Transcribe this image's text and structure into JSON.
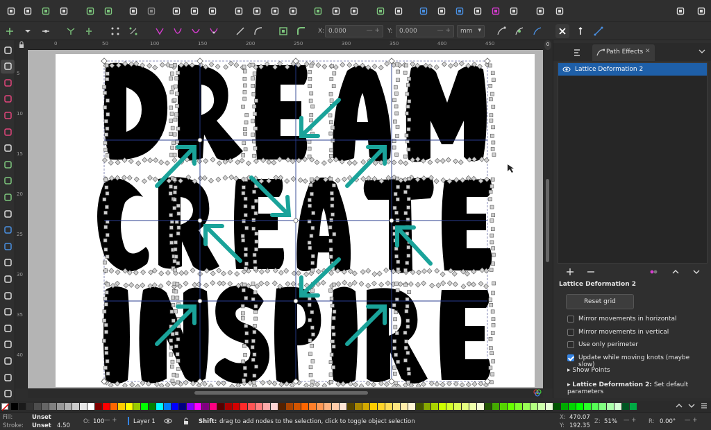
{
  "command_bar": {
    "icons": [
      "new-document-icon",
      "open-icon",
      "save-icon",
      "print-icon",
      "import-icon",
      "export-icon",
      "undo-icon",
      "redo-icon",
      "copy-icon",
      "cut-icon",
      "paste-icon",
      "zoom-selection-icon",
      "zoom-drawing-icon",
      "zoom-page-icon",
      "zoom-fit-icon",
      "group-icon",
      "ungroup-icon",
      "duplicate-icon",
      "clone-icon",
      "unlink-clone-icon",
      "fill-stroke-icon",
      "text-font-icon",
      "layers-icon",
      "xml-editor-icon",
      "align-distribute-icon",
      "object-properties-icon",
      "find-replace-icon",
      "preferences-icon",
      "snap-toggle-icon",
      "commands-more-icon"
    ]
  },
  "tool_controls": {
    "x_label": "X:",
    "x_value": "0.000",
    "y_label": "Y:",
    "y_value": "0.000",
    "unit": "mm"
  },
  "toolbox": {
    "tools": [
      "selector-tool-icon",
      "node-tool-icon",
      "rectangle-tool-icon",
      "ellipse-tool-icon",
      "star-tool-icon",
      "3dbox-tool-icon",
      "spiral-tool-icon",
      "pencil-tool-icon",
      "pen-tool-icon",
      "calligraphy-tool-icon",
      "text-tool-icon",
      "gradient-tool-icon",
      "mesh-tool-icon",
      "dropper-tool-icon",
      "paint-bucket-tool-icon",
      "tweak-tool-icon",
      "spray-tool-icon",
      "eraser-tool-icon",
      "connector-tool-icon",
      "measure-tool-icon",
      "zoom-tool-icon",
      "pages-tool-icon"
    ]
  },
  "rulers": {
    "top_labels": [
      "0",
      "50",
      "100",
      "150",
      "200",
      "250",
      "300",
      "350",
      "400",
      "450"
    ],
    "left_labels": [
      "5",
      "10",
      "15",
      "20",
      "25",
      "30",
      "35",
      "40"
    ]
  },
  "canvas": {
    "words": [
      "DREAM",
      "CREATE",
      "INSPIRE"
    ],
    "arrow_color": "#1aa39a",
    "grid_color": "#2a3d8f"
  },
  "dock": {
    "tab_label": "Path Effects",
    "lpe_item": "Lattice Deformation 2",
    "param_title": "Lattice Deformation 2",
    "reset_label": "Reset grid",
    "checkboxes": [
      {
        "label": "Mirror movements in horizontal",
        "checked": false
      },
      {
        "label": "Mirror movements in vertical",
        "checked": false
      },
      {
        "label": "Use only perimeter",
        "checked": false
      },
      {
        "label": "Update while moving knots (maybe slow)",
        "checked": true
      }
    ],
    "show_points": "Show Points",
    "defaults_bold": "Lattice Deformation 2:",
    "defaults_rest": "Set default parameters"
  },
  "status": {
    "fill_label": "Fill:",
    "fill_value": "Unset",
    "stroke_label": "Stroke:",
    "stroke_value": "Unset",
    "stroke_width": "4.50",
    "opacity_label": "O:",
    "opacity_value": "100",
    "layer": "Layer 1",
    "message_bold": "Shift:",
    "message": "drag to add nodes to the selection, click to toggle object selection",
    "x_label": "X:",
    "x_value": "470.07",
    "y_label": "Y:",
    "y_value": "192.35",
    "zoom_label": "Z:",
    "zoom_value": "51%",
    "rotation_label": "R:",
    "rotation_value": "0.00°"
  },
  "palette_colors": [
    "#000000",
    "#1a1a1a",
    "#333333",
    "#4d4d4d",
    "#666666",
    "#808080",
    "#999999",
    "#b3b3b3",
    "#cccccc",
    "#e6e6e6",
    "#ffffff",
    "#800000",
    "#ff0000",
    "#ff6600",
    "#ffcc00",
    "#ffff00",
    "#99cc00",
    "#00ff00",
    "#008000",
    "#00ffff",
    "#0080ff",
    "#0000ff",
    "#000080",
    "#8000ff",
    "#ff00ff",
    "#800080",
    "#ff0080",
    "#550000",
    "#aa0000",
    "#d40000",
    "#ff2a2a",
    "#ff5555",
    "#ff8080",
    "#ffaaaa",
    "#ffd5d5",
    "#552200",
    "#aa4400",
    "#d45500",
    "#ff6600",
    "#ff7f2a",
    "#ff9955",
    "#ffb380",
    "#ffccaa",
    "#ffe6d5",
    "#554400",
    "#aa8800",
    "#d4aa00",
    "#ffcc00",
    "#ffd42a",
    "#ffdd55",
    "#ffe680",
    "#ffeeaa",
    "#fff6d5",
    "#445500",
    "#88aa00",
    "#aad400",
    "#ccff00",
    "#d4ff2a",
    "#ddff55",
    "#e5ff80",
    "#eeffaa",
    "#f6ffd5",
    "#225500",
    "#44aa00",
    "#55d400",
    "#66ff00",
    "#7fff2a",
    "#99ff55",
    "#b3ff80",
    "#ccffaa",
    "#e6ffd5",
    "#005500",
    "#00aa00",
    "#00d400",
    "#00ff00",
    "#2aff2a",
    "#55ff55",
    "#80ff80",
    "#aaffaa",
    "#d5ffd5",
    "#005522",
    "#00aa44"
  ]
}
